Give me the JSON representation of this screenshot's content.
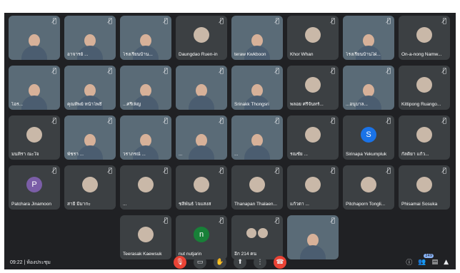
{
  "tiles": [
    {
      "name": "",
      "video": true
    },
    {
      "name": "อาจารย์ ...",
      "video": true
    },
    {
      "name": "โรงเรียนบ้าน...",
      "video": true
    },
    {
      "name": "Daungdao Ruen-in",
      "video": false
    },
    {
      "name": "teraw Kwkboon",
      "video": true
    },
    {
      "name": "Khor Whan",
      "video": false
    },
    {
      "name": "โรงเรียนบ้านไผ่...",
      "video": true
    },
    {
      "name": "On-a-nong Namw...",
      "video": false
    },
    {
      "name": "ไอร...",
      "video": true
    },
    {
      "name": "คุณทิพย์ หน้าโพธิ์",
      "video": true
    },
    {
      "name": "...ศรีเพ็ญ",
      "video": true
    },
    {
      "name": "",
      "video": true
    },
    {
      "name": "Srinakk Thongsri",
      "video": true
    },
    {
      "name": "พลอย ศรีจันทร์...",
      "video": false
    },
    {
      "name": "...อนุบาล...",
      "video": true
    },
    {
      "name": "Kittipong Ruango...",
      "video": false
    },
    {
      "name": "มนทิรา ณะใจ",
      "video": false
    },
    {
      "name": "พัชรา ...",
      "video": true
    },
    {
      "name": "วราภรณ์ ...",
      "video": true
    },
    {
      "name": "...",
      "video": true
    },
    {
      "name": "...",
      "video": true
    },
    {
      "name": "รณชัย ...",
      "video": false
    },
    {
      "name": "Sirinapa Yekumpluk",
      "video": false,
      "letter": "S",
      "color": "blue"
    },
    {
      "name": "กัลติยา แก้ว...",
      "video": false
    },
    {
      "name": "Patchara Jinamoon",
      "video": false,
      "letter": "P",
      "color": "purple"
    },
    {
      "name": "สายี มีมากะ",
      "video": false
    },
    {
      "name": "...",
      "video": false
    },
    {
      "name": "ชลีพันธ์ โจแสงส",
      "video": false
    },
    {
      "name": "Thanapan Thalaen...",
      "video": false
    },
    {
      "name": "แก้วตา ...",
      "video": false
    },
    {
      "name": "Pitchaporn Tongli...",
      "video": false
    },
    {
      "name": "Phisamai Sosuka",
      "video": false
    },
    {
      "name": "Teerasak Kaewsuk",
      "video": false
    },
    {
      "name": "nut nutjarin",
      "video": false,
      "letter": "n",
      "color": "green"
    },
    {
      "name": "อีก 214 คน",
      "video": false,
      "pair": true
    },
    {
      "name": "",
      "video": true
    }
  ],
  "footer": {
    "time": "09:22",
    "meeting": "ห้องประชุม",
    "participants_badge": "249"
  },
  "icons": [
    "mic-icon",
    "camera-icon",
    "raise-hand-icon",
    "present-icon",
    "more-icon",
    "end-call-icon",
    "info-icon",
    "people-icon",
    "chat-icon",
    "activities-icon"
  ]
}
